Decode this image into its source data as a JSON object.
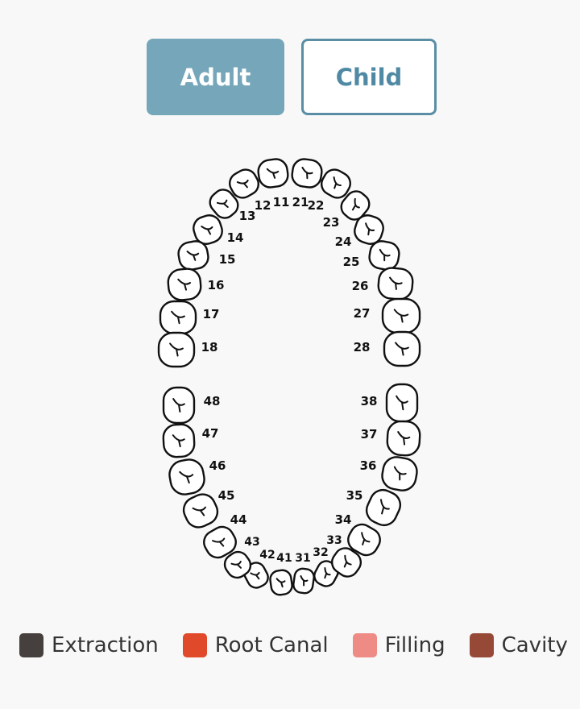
{
  "mode_toggle": {
    "adult_label": "Adult",
    "child_label": "Child",
    "selected": "Adult"
  },
  "tooth_chart": {
    "upper_right": [
      "11",
      "12",
      "13",
      "14",
      "15",
      "16",
      "17",
      "18"
    ],
    "upper_left": [
      "21",
      "22",
      "23",
      "24",
      "25",
      "26",
      "27",
      "28"
    ],
    "lower_left": [
      "31",
      "32",
      "33",
      "34",
      "35",
      "36",
      "37",
      "38"
    ],
    "lower_right": [
      "41",
      "42",
      "43",
      "44",
      "45",
      "46",
      "47",
      "48"
    ]
  },
  "legend": [
    {
      "label": "Extraction",
      "color": "#45403d"
    },
    {
      "label": "Root Canal",
      "color": "#e04a2a"
    },
    {
      "label": "Filling",
      "color": "#ef8b85"
    },
    {
      "label": "Cavity",
      "color": "#964937"
    }
  ],
  "colors": {
    "active_button": "#76a6b9",
    "inactive_border": "#5a8ea5",
    "tooth_outline": "#111111",
    "tooth_fill": "#ffffff"
  }
}
